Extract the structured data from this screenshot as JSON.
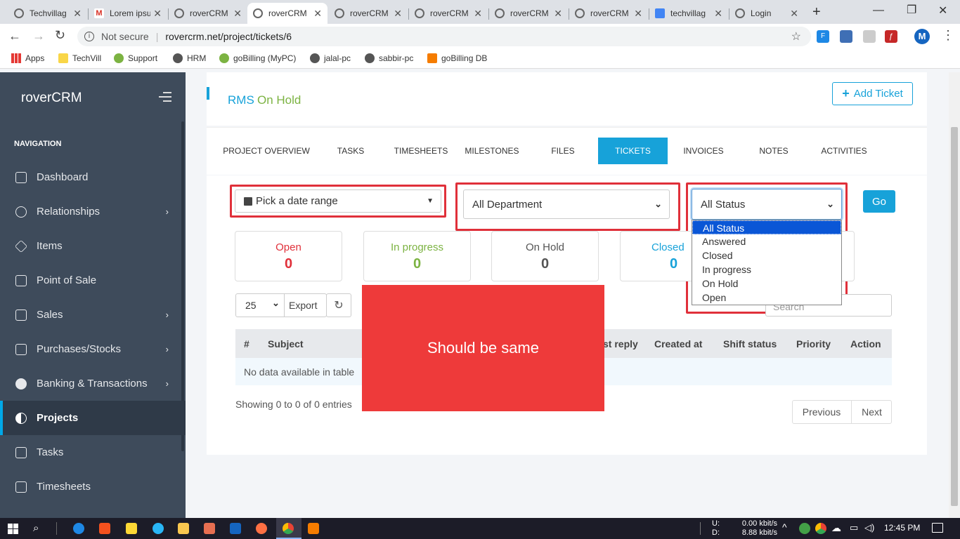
{
  "browser": {
    "tabs": [
      {
        "title": "Techvillag",
        "favicon": "globe-icon"
      },
      {
        "title": "Lorem ipsu",
        "favicon": "gmail-icon"
      },
      {
        "title": "roverCRM",
        "favicon": "globe-icon"
      },
      {
        "title": "roverCRM",
        "favicon": "globe-icon",
        "active": true
      },
      {
        "title": "roverCRM",
        "favicon": "globe-icon"
      },
      {
        "title": "roverCRM",
        "favicon": "globe-icon"
      },
      {
        "title": "roverCRM",
        "favicon": "globe-icon"
      },
      {
        "title": "roverCRM",
        "favicon": "globe-icon"
      },
      {
        "title": "techvillag",
        "favicon": "techvill-icon"
      },
      {
        "title": "Login",
        "favicon": "globe-icon"
      }
    ],
    "security": "Not secure",
    "url": "rovercrm.net/project/tickets/6",
    "profile_initial": "M",
    "bookmarks": [
      "Apps",
      "TechVill",
      "Support",
      "HRM",
      "goBilling (MyPC)",
      "jalal-pc",
      "sabbir-pc",
      "goBilling DB"
    ]
  },
  "sidebar": {
    "brand": "roverCRM",
    "section": "NAVIGATION",
    "items": [
      {
        "label": "Dashboard",
        "icon": "home-icon",
        "chevron": false
      },
      {
        "label": "Relationships",
        "icon": "users-icon",
        "chevron": true
      },
      {
        "label": "Items",
        "icon": "layers-icon",
        "chevron": false
      },
      {
        "label": "Point of Sale",
        "icon": "briefcase-icon",
        "chevron": false
      },
      {
        "label": "Sales",
        "icon": "box-icon",
        "chevron": true
      },
      {
        "label": "Purchases/Stocks",
        "icon": "cart-icon",
        "chevron": true
      },
      {
        "label": "Banking & Transactions",
        "icon": "piggybank-icon",
        "chevron": true
      },
      {
        "label": "Projects",
        "icon": "half-circle-icon",
        "chevron": false,
        "active": true
      },
      {
        "label": "Tasks",
        "icon": "clipboard-icon",
        "chevron": false
      },
      {
        "label": "Timesheets",
        "icon": "calendar-icon",
        "chevron": false
      }
    ]
  },
  "header": {
    "project": "RMS",
    "status": "On Hold",
    "add_ticket": "Add Ticket"
  },
  "tabs": [
    "PROJECT OVERVIEW",
    "TASKS",
    "TIMESHEETS",
    "MILESTONES",
    "FILES",
    "TICKETS",
    "INVOICES",
    "NOTES",
    "ACTIVITIES"
  ],
  "filters": {
    "date": "Pick a date range",
    "department": "All Department",
    "status": "All Status",
    "go": "Go",
    "status_options": [
      "All Status",
      "Answered",
      "Closed",
      "In progress",
      "On Hold",
      "Open"
    ]
  },
  "stats": [
    {
      "label": "Open",
      "value": "0",
      "color": "#e0303a"
    },
    {
      "label": "In progress",
      "value": "0",
      "color": "#7cb342"
    },
    {
      "label": "On Hold",
      "value": "0",
      "color": "#555555"
    },
    {
      "label": "Closed",
      "value": "0",
      "color": "#17a2d9"
    }
  ],
  "table": {
    "page_size": "25",
    "export": "Export",
    "search_placeholder": "Search",
    "columns": [
      "#",
      "Subject",
      "st reply",
      "Created at",
      "Shift status",
      "Priority",
      "Action"
    ],
    "empty": "No data available in table",
    "info": "Showing 0 to 0 of 0 entries",
    "prev": "Previous",
    "next": "Next"
  },
  "annotation": {
    "text": "Should be same",
    "color": "#ee3a3a"
  },
  "taskbar": {
    "net_up_label": "U:",
    "net_down_label": "D:",
    "net_up": "0.00 kbit/s",
    "net_down": "8.88 kbit/s",
    "time": "12:45 PM"
  },
  "colors": {
    "accent": "#17a2d9",
    "sidebar": "#3e4b5b",
    "onhold": "#7cb342"
  }
}
